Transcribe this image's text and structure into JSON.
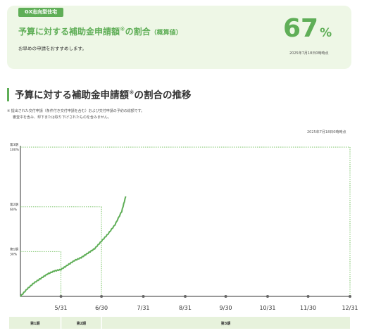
{
  "card": {
    "tag": "GX志向型住宅",
    "title_main": "予算に対する補助金申請額",
    "title_mark": "※",
    "title_tail": "の割合",
    "title_paren": "（概算値）",
    "note": "お早めの申請をおすすめします。",
    "percent_value": "67",
    "percent_unit": "%",
    "date": "2025年7月18日0時時点"
  },
  "section": {
    "title_main": "予算に対する補助金申請額",
    "title_mark": "※",
    "title_tail": "の割合の推移",
    "note_line1": "※ 提出された交付申請（条件付き交付申請を含む）および交付申請の予約の総額です。",
    "note_line2": "審査中を含み、却下または取り下げされたものを含みません。",
    "date": "2025年7月18日0時時点"
  },
  "chart_data": {
    "type": "line",
    "series": [
      {
        "x": [
          "5/1",
          "5/6",
          "5/11",
          "5/16",
          "5/21",
          "5/26",
          "5/31",
          "6/5",
          "6/10",
          "6/15",
          "6/20",
          "6/25",
          "6/30",
          "7/5",
          "7/10",
          "7/15",
          "7/18"
        ],
        "values": [
          0,
          5,
          9,
          12,
          15,
          17,
          18,
          21,
          24,
          26,
          29,
          32,
          37,
          42,
          48,
          57,
          67
        ]
      }
    ],
    "x_ticks": [
      "5/31",
      "6/30",
      "7/31",
      "8/31",
      "9/30",
      "10/31",
      "11/30",
      "12/31"
    ],
    "ylim": [
      0,
      100
    ],
    "milestones": [
      {
        "phase": "第1期",
        "value": 30,
        "label": "30%",
        "date": "5/31"
      },
      {
        "phase": "第2期",
        "value": 60,
        "label": "60%",
        "date": "6/30"
      },
      {
        "phase": "第3期",
        "value": 100,
        "label": "100%",
        "date": "12/31"
      }
    ],
    "phases": [
      "第1期",
      "第2期",
      "第3期"
    ],
    "colors": {
      "line": "#5fae57",
      "guide": "#7cc46a",
      "phase_bg": "#e7f2dc"
    }
  }
}
